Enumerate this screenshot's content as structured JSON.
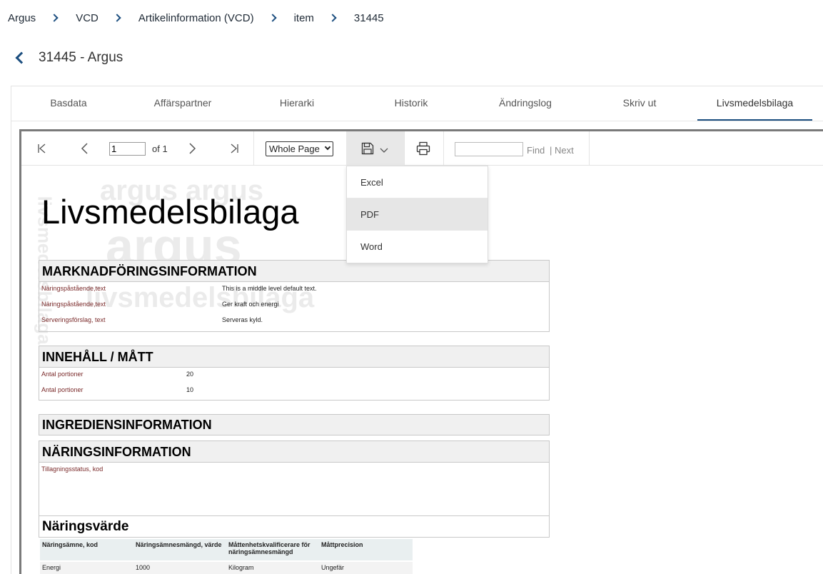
{
  "breadcrumb": [
    "Argus",
    "VCD",
    "Artikelinformation (VCD)",
    "item",
    "31445"
  ],
  "page_title": "31445 - Argus",
  "tabs": [
    "Basdata",
    "Affärspartner",
    "Hierarki",
    "Historik",
    "Ändringslog",
    "Skriv ut",
    "Livsmedelsbilaga"
  ],
  "active_tab": "Livsmedelsbilaga",
  "toolbar": {
    "page_value": "1",
    "of_label": "of 1",
    "zoom": "Whole Page",
    "find_label": "Find",
    "next_label": "Next",
    "separator": "|"
  },
  "export_menu": [
    "Excel",
    "PDF",
    "Word"
  ],
  "export_menu_hover": "PDF",
  "report": {
    "title": "Livsmedelsbilaga",
    "watermark": {
      "line1": "argus argus",
      "line2": "argus",
      "line3": "livsmedelsbilaga",
      "vertical": "livsmedelsbilaga"
    },
    "sections": {
      "marknad": {
        "title": "MARKNADFÖRINGSINFORMATION",
        "rows": [
          {
            "label": "Näringspåstående,text",
            "value": "This is a middle level default text."
          },
          {
            "label": "Näringspåstående,text",
            "value": "Ger kraft och energi"
          },
          {
            "label": "Serveringsförslag, text",
            "value": "Serveras kyld."
          }
        ]
      },
      "innehall": {
        "title": "INNEHÅLL / MÅTT",
        "rows": [
          {
            "label": "Antal portioner",
            "value": "20"
          },
          {
            "label": "Antal portioner",
            "value": "10"
          }
        ]
      },
      "ingrediens": {
        "title": "INGREDIENSINFORMATION"
      },
      "naring": {
        "title": "NÄRINGSINFORMATION",
        "rows": [
          {
            "label": "Tillagningsstatus, kod",
            "value": ""
          }
        ]
      },
      "naringsvarde": {
        "title": "Näringsvärde",
        "columns": [
          "Näringsämne, kod",
          "Näringsämnesmängd, värde",
          "Måttenhetskvalificerare för näringsämnesmängd",
          "Måttprecision"
        ],
        "rows": [
          [
            "Energi",
            "1000",
            "Kilogram",
            "Ungefär"
          ]
        ]
      }
    }
  },
  "colors": {
    "accent": "#1c4e7f",
    "label_red": "#7a2a2a",
    "section_bg": "#f0f0f0"
  }
}
